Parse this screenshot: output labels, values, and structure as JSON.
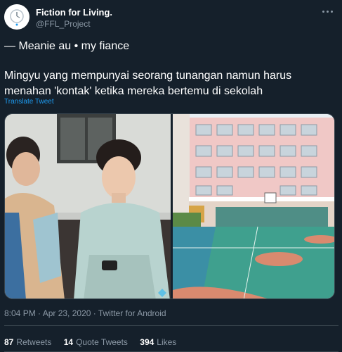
{
  "author": {
    "name": "Fiction for Living.",
    "handle": "@FFL_Project"
  },
  "tweet": {
    "line1": "— Meanie au • my fiance",
    "body": "Mingyu yang mempunyai seorang tunangan namun harus menahan 'kontak' ketika mereka bertemu di sekolah",
    "translate_label": "Translate Tweet"
  },
  "meta": {
    "time": "8:04 PM",
    "date": "Apr 23, 2020",
    "source": "Twitter for Android",
    "text": "8:04 PM · Apr 23, 2020 · Twitter for Android"
  },
  "stats": {
    "retweets_count": "87",
    "retweets_label": "Retweets",
    "quotes_count": "14",
    "quotes_label": "Quote Tweets",
    "likes_count": "394",
    "likes_label": "Likes"
  },
  "icons": {
    "more": "more-horizontal-icon",
    "avatar": "clock-logo-icon"
  },
  "colors": {
    "background": "#15202b",
    "accent": "#1d9bf0",
    "muted": "#8b98a5",
    "border": "#38444d"
  }
}
